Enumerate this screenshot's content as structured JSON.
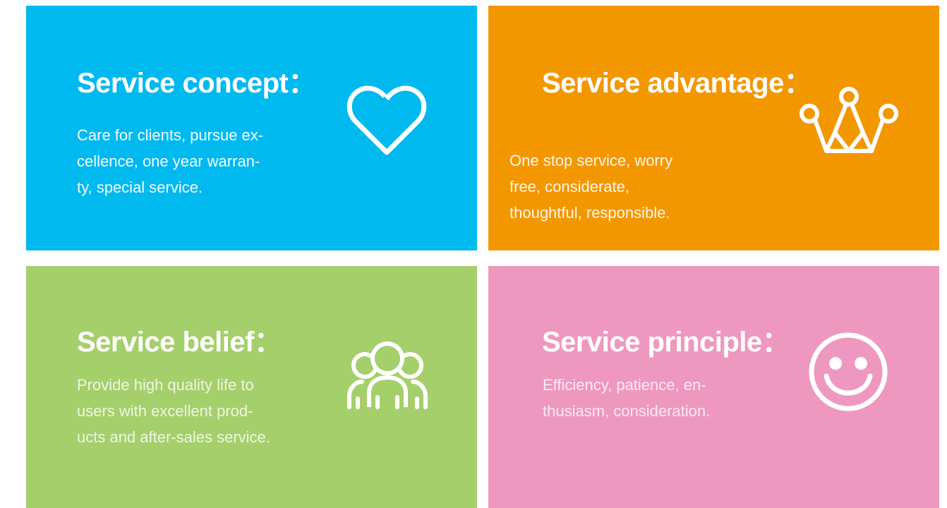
{
  "colors": {
    "concept": "#00b9ef",
    "advantage": "#f39700",
    "belief": "#a5cf6b",
    "principle": "#ee98bf"
  },
  "cards": [
    {
      "title": "Service concept：",
      "icon": "heart-icon",
      "lines": [
        "Care for clients, pursue ex-",
        "cellence, one year warran-",
        "ty, special service."
      ]
    },
    {
      "title": "Service advantage：",
      "icon": "crown-icon",
      "lines": [
        "One stop service, worry",
        "free, considerate,",
        "thoughtful, responsible."
      ]
    },
    {
      "title": "Service belief：",
      "icon": "group-icon",
      "lines": [
        "Provide high quality life to",
        "users with excellent prod-",
        "ucts and after-sales service."
      ]
    },
    {
      "title": "Service principle：",
      "icon": "smiley-icon",
      "lines": [
        "Efficiency, patience, en-",
        "thusiasm, consideration."
      ]
    }
  ]
}
